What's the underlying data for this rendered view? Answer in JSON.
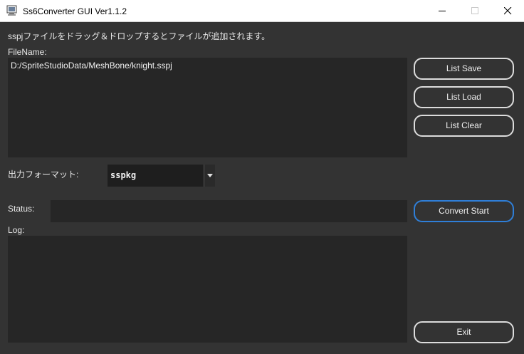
{
  "window": {
    "title": "Ss6Converter GUI Ver1.1.2"
  },
  "instructions": "sspjファイルをドラッグ＆ドロップするとファイルが追加されます。",
  "file_list": {
    "label": "FileName:",
    "items": [
      "D:/SpriteStudioData/MeshBone/knight.sspj"
    ]
  },
  "buttons": {
    "list_save": "List Save",
    "list_load": "List Load",
    "list_clear": "List Clear",
    "convert_start": "Convert Start",
    "exit": "Exit"
  },
  "output_format": {
    "label": "出力フォーマット:",
    "selected": "sspkg"
  },
  "status": {
    "label": "Status:",
    "value": ""
  },
  "log": {
    "label": "Log:",
    "value": ""
  },
  "colors": {
    "background": "#333333",
    "panel": "#262626",
    "accent": "#2f7fd8"
  }
}
